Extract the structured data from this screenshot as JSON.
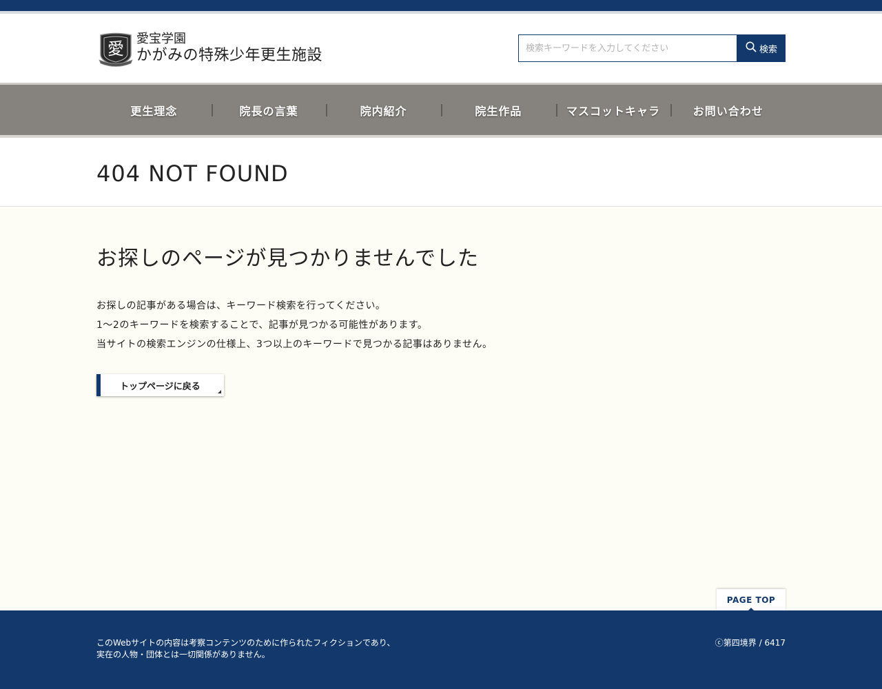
{
  "header": {
    "logo_emblem_char": "愛",
    "logo_small": "愛宝学園",
    "logo_large": "かがみの特殊少年更生施設",
    "search": {
      "placeholder": "検索キーワードを入力してください",
      "value": "",
      "button_label": "検索",
      "icon": "search-icon"
    }
  },
  "nav": {
    "items": [
      {
        "label": "更生理念"
      },
      {
        "label": "院長の言葉"
      },
      {
        "label": "院内紹介"
      },
      {
        "label": "院生作品"
      },
      {
        "label": "マスコットキャラ"
      },
      {
        "label": "お問い合わせ"
      }
    ]
  },
  "page": {
    "title": "404 NOT FOUND",
    "heading": "お探しのページが見つかりませんでした",
    "messages": [
      "お探しの記事がある場合は、キーワード検索を行ってください。",
      "1〜2のキーワードを検索することで、記事が見つかる可能性があります。",
      "当サイトの検索エンジンの仕様上、3つ以上のキーワードで見つかる記事はありません。"
    ],
    "back_button": "トップページに戻る"
  },
  "page_top": "PAGE TOP",
  "footer": {
    "lines": [
      "このWebサイトの内容は考察コンテンツのために作られたフィクションであり、",
      "実在の人物・団体とは一切関係がありません。"
    ],
    "copyright": "ⓒ第四境界 / 6417"
  },
  "colors": {
    "brand_navy": "#13386b",
    "nav_gray": "#86827d",
    "content_bg": "#fdfdf5"
  }
}
